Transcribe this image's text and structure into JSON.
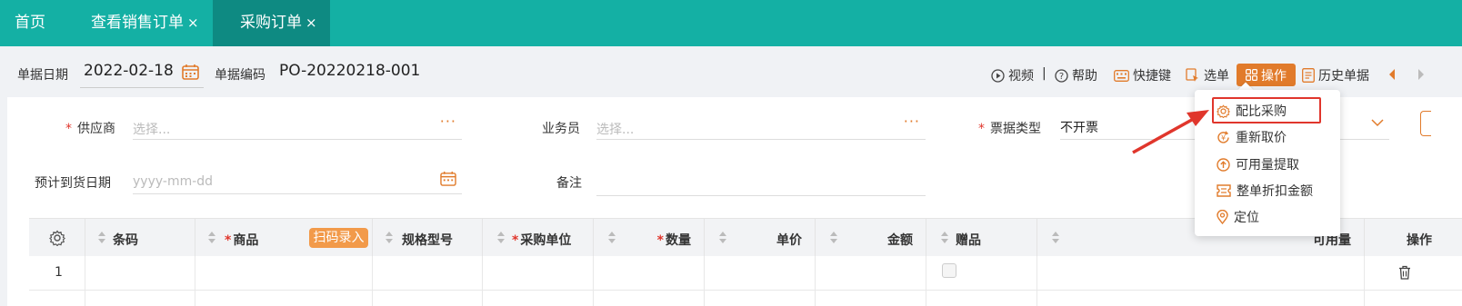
{
  "tabs": [
    {
      "label": "首页",
      "closable": false
    },
    {
      "label": "查看销售订单",
      "closable": true
    },
    {
      "label": "采购订单",
      "closable": true,
      "active": true
    }
  ],
  "tab_close_glyph": "×",
  "header": {
    "date_label": "单据日期",
    "date_value": "2022-02-18",
    "code_label": "单据编码",
    "code_value": "PO-20220218-001"
  },
  "toolbar": {
    "video": "视频",
    "separator": "|",
    "help": "帮助",
    "shortcut": "快捷键",
    "select": "选单",
    "operate": "操作",
    "history": "历史单据"
  },
  "form": {
    "supplier_label": "供应商",
    "supplier_placeholder": "选择...",
    "salesman_label": "业务员",
    "salesman_placeholder": "选择...",
    "invoice_type_label": "票据类型",
    "invoice_type_value": "不开票",
    "arrival_date_label": "预计到货日期",
    "arrival_date_placeholder": "yyyy-mm-dd",
    "remark_label": "备注",
    "required_mark": "*",
    "more_glyph": "···"
  },
  "table": {
    "columns": [
      {
        "label": "条码",
        "required": false
      },
      {
        "label": "商品",
        "required": true
      },
      {
        "label": "规格型号",
        "required": false
      },
      {
        "label": "采购单位",
        "required": true
      },
      {
        "label": "数量",
        "required": true
      },
      {
        "label": "单价",
        "required": false
      },
      {
        "label": "金额",
        "required": false
      },
      {
        "label": "赠品",
        "required": false
      },
      {
        "label": "可用量",
        "required": false
      },
      {
        "label": "操作",
        "required": false
      }
    ],
    "scan_button": "扫码录入",
    "rows": [
      {
        "index": "1"
      }
    ]
  },
  "menu": {
    "items": [
      {
        "label": "配比采购",
        "icon": "gear-icon",
        "highlighted": true
      },
      {
        "label": "重新取价",
        "icon": "price-refresh-icon"
      },
      {
        "label": "可用量提取",
        "icon": "upload-circle-icon"
      },
      {
        "label": "整单折扣金额",
        "icon": "ticket-icon"
      },
      {
        "label": "定位",
        "icon": "location-pin-icon"
      }
    ]
  },
  "colors": {
    "tab_bar": "#14b0a4",
    "tab_active": "#0e8a82",
    "accent": "#e17b2b",
    "highlight_red": "#e0362c"
  }
}
